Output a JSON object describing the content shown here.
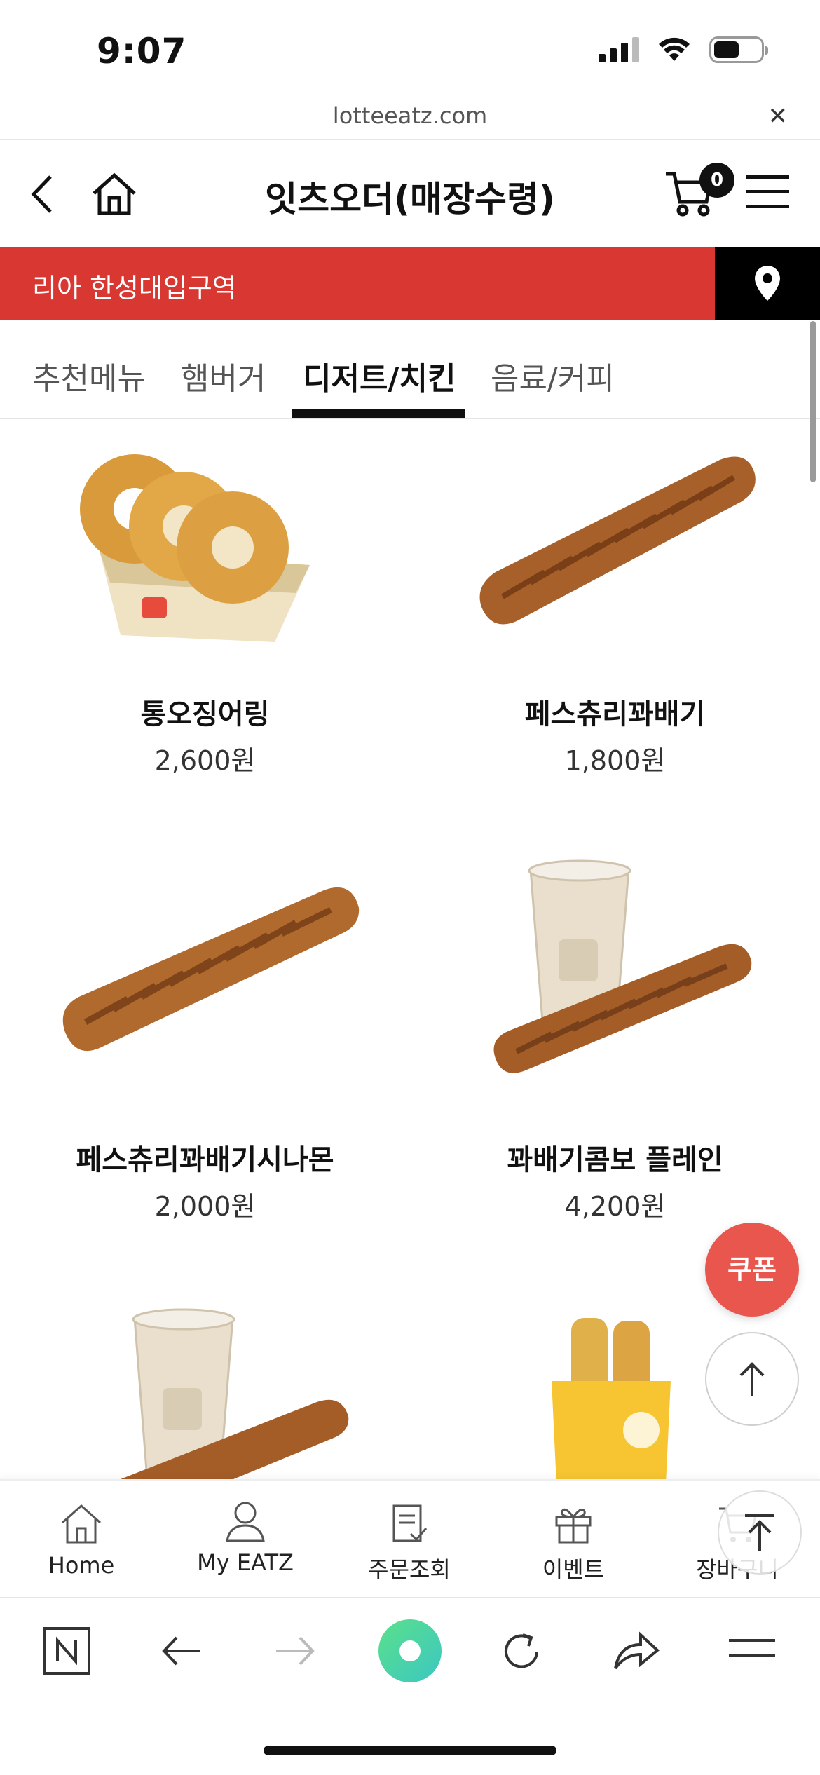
{
  "status_bar": {
    "time": "9:07"
  },
  "browser": {
    "url": "lotteeatz.com"
  },
  "header": {
    "title": "잇츠오더(매장수령)",
    "cart_count": "0"
  },
  "location": {
    "store": "리아 한성대입구역"
  },
  "tabs": [
    {
      "label": "추천메뉴",
      "active": false
    },
    {
      "label": "햄버거",
      "active": false
    },
    {
      "label": "디저트/치킨",
      "active": true
    },
    {
      "label": "음료/커피",
      "active": false
    }
  ],
  "products": [
    {
      "name": "통오징어링",
      "price": "2,600원",
      "image": "squid-rings"
    },
    {
      "name": "페스츄리꽈배기",
      "price": "1,800원",
      "image": "twisted-pastry"
    },
    {
      "name": "페스츄리꽈배기시나몬",
      "price": "2,000원",
      "image": "cinnamon-twisted-pastry"
    },
    {
      "name": "꽈배기콤보 플레인",
      "price": "4,200원",
      "image": "twist-combo-drink"
    },
    {
      "name": "",
      "price": "",
      "image": "twist-combo-drink"
    },
    {
      "name": "",
      "price": "",
      "image": "cheese-sticks"
    }
  ],
  "floating": {
    "coupon_label": "쿠폰"
  },
  "bottom_nav": [
    {
      "label": "Home",
      "icon": "home-icon"
    },
    {
      "label": "My EATZ",
      "icon": "person-icon"
    },
    {
      "label": "주문조회",
      "icon": "receipt-icon"
    },
    {
      "label": "이벤트",
      "icon": "gift-icon"
    },
    {
      "label": "장바구니",
      "icon": "cart-icon"
    }
  ],
  "colors": {
    "accent_red": "#d93832",
    "coupon": "#e8564e",
    "naver_green": "#3ddc97"
  }
}
